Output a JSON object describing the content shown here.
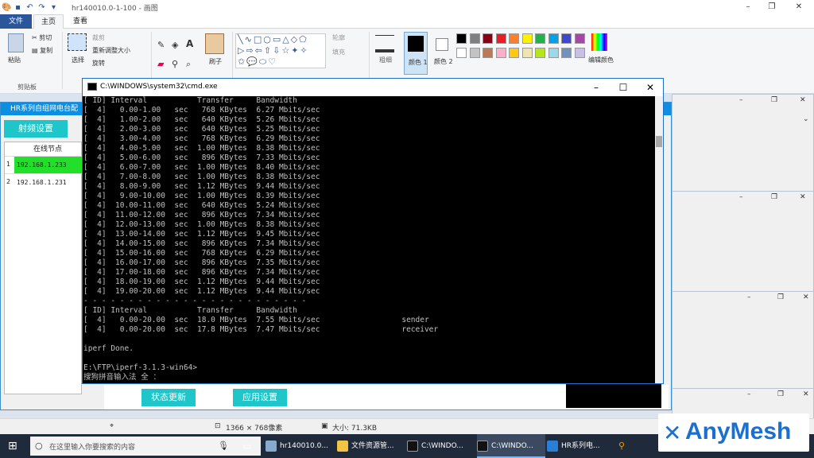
{
  "paint": {
    "title": "hr140010.0-1-100 - 画图",
    "tabs": [
      "文件",
      "主页",
      "查看"
    ],
    "clipboard": {
      "paste": "粘贴",
      "cut": "剪切",
      "copy": "复制",
      "group": "剪贴板"
    },
    "image": {
      "select": "选择",
      "crop": "裁剪",
      "resize": "重新调整大小",
      "rotate": "旋转"
    },
    "tools": {
      "brush": "刷子"
    },
    "shapes": {
      "outline": "轮廓",
      "fill": "填充"
    },
    "size": "粗细",
    "color1": "颜色 1",
    "color2": "颜色 2",
    "edit_colors": "编辑颜色",
    "palette": [
      "#000000",
      "#7f7f7f",
      "#880015",
      "#ed1c24",
      "#ff7f27",
      "#fff200",
      "#22b14c",
      "#00a2e8",
      "#3f48cc",
      "#a349a4",
      "#ffffff",
      "#c3c3c3",
      "#b97a57",
      "#ffaec9",
      "#ffc90e",
      "#efe4b0",
      "#b5e61d",
      "#99d9ea",
      "#7092be",
      "#c8bfe7"
    ]
  },
  "hr_app": {
    "title": "HR系列自组网电台配",
    "tab": "射频设置",
    "online_header": "在线节点",
    "nodes": [
      {
        "n": "1",
        "ip": "192.168.1.233",
        "active": true
      },
      {
        "n": "2",
        "ip": "192.168.1.231",
        "active": false
      }
    ],
    "status_button": "状态更新",
    "apply_button": "应用设置"
  },
  "cmd": {
    "title": "C:\\WINDOWS\\system32\\cmd.exe",
    "lines": [
      "[ ID] Interval           Transfer     Bandwidth",
      "[  4]   0.00-1.00   sec   768 KBytes  6.27 Mbits/sec",
      "[  4]   1.00-2.00   sec   640 KBytes  5.26 Mbits/sec",
      "[  4]   2.00-3.00   sec   640 KBytes  5.25 Mbits/sec",
      "[  4]   3.00-4.00   sec   768 KBytes  6.29 Mbits/sec",
      "[  4]   4.00-5.00   sec  1.00 MBytes  8.38 Mbits/sec",
      "[  4]   5.00-6.00   sec   896 KBytes  7.33 Mbits/sec",
      "[  4]   6.00-7.00   sec  1.00 MBytes  8.40 Mbits/sec",
      "[  4]   7.00-8.00   sec  1.00 MBytes  8.38 Mbits/sec",
      "[  4]   8.00-9.00   sec  1.12 MBytes  9.44 Mbits/sec",
      "[  4]   9.00-10.00  sec  1.00 MBytes  8.39 Mbits/sec",
      "[  4]  10.00-11.00  sec   640 KBytes  5.24 Mbits/sec",
      "[  4]  11.00-12.00  sec   896 KBytes  7.34 Mbits/sec",
      "[  4]  12.00-13.00  sec  1.00 MBytes  8.38 Mbits/sec",
      "[  4]  13.00-14.00  sec  1.12 MBytes  9.45 Mbits/sec",
      "[  4]  14.00-15.00  sec   896 KBytes  7.34 Mbits/sec",
      "[  4]  15.00-16.00  sec   768 KBytes  6.29 Mbits/sec",
      "[  4]  16.00-17.00  sec   896 KBytes  7.35 Mbits/sec",
      "[  4]  17.00-18.00  sec   896 KBytes  7.34 Mbits/sec",
      "[  4]  18.00-19.00  sec  1.12 MBytes  9.44 Mbits/sec",
      "[  4]  19.00-20.00  sec  1.12 MBytes  9.44 Mbits/sec",
      "- - - - - - - - - - - - - - - - - - - - - - - - -",
      "[ ID] Interval           Transfer     Bandwidth",
      "[  4]   0.00-20.00  sec  18.0 MBytes  7.55 Mbits/sec                  sender",
      "[  4]   0.00-20.00  sec  17.8 MBytes  7.47 Mbits/sec                  receiver",
      "",
      "iperf Done.",
      "",
      "E:\\FTP\\iperf-3.1.3-win64>",
      "搜狗拼音输入法 全 ："
    ]
  },
  "status": {
    "dimensions": "1366 × 768像素",
    "size": "大小: 71.3KB"
  },
  "taskbar": {
    "search_placeholder": "在这里输入你要搜索的内容",
    "items": [
      "hr140010.0...",
      "文件资源管...",
      "C:\\WINDO...",
      "C:\\WINDO...",
      "HR系列电..."
    ]
  },
  "watermark": "AnyMesh"
}
